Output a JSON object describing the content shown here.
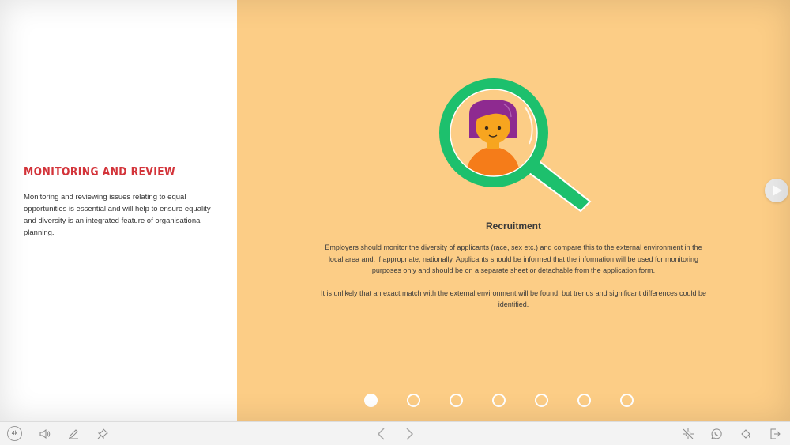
{
  "left": {
    "title": "Monitoring and Review",
    "body": "Monitoring and reviewing issues relating to equal opportunities is essential and will help to ensure equality and diversity is an integrated feature of organisational planning."
  },
  "right": {
    "illustration": "magnifier-with-woman-icon",
    "heading": "Recruitment",
    "paragraph1": "Employers should monitor the diversity of applicants (race, sex etc.) and compare this to the external environment in the local area and, if appropriate, nationally. Applicants should be informed that the information will be used for monitoring purposes only and should be on a separate sheet or detachable from the application form.",
    "paragraph2": "It is unlikely that an exact match with the external environment will be found, but trends and significant differences could be identified.",
    "pagination": {
      "total": 7,
      "active": 1
    }
  },
  "toolbar": {
    "resolution_label": "4k",
    "left_icons": [
      "speaker-icon",
      "pencil-icon",
      "pin-icon"
    ],
    "nav_icons": [
      "prev-arrow-icon",
      "next-arrow-icon"
    ],
    "right_icons": [
      "no-animation-icon",
      "whatsapp-icon",
      "paint-bucket-icon",
      "exit-icon"
    ]
  },
  "colors": {
    "right_background": "#fccd86",
    "title_red": "#d3343a",
    "magnifier_green": "#1dc06d",
    "hair_purple": "#8e2a90",
    "shirt_orange": "#f57c19",
    "skin": "#f7a51f"
  }
}
